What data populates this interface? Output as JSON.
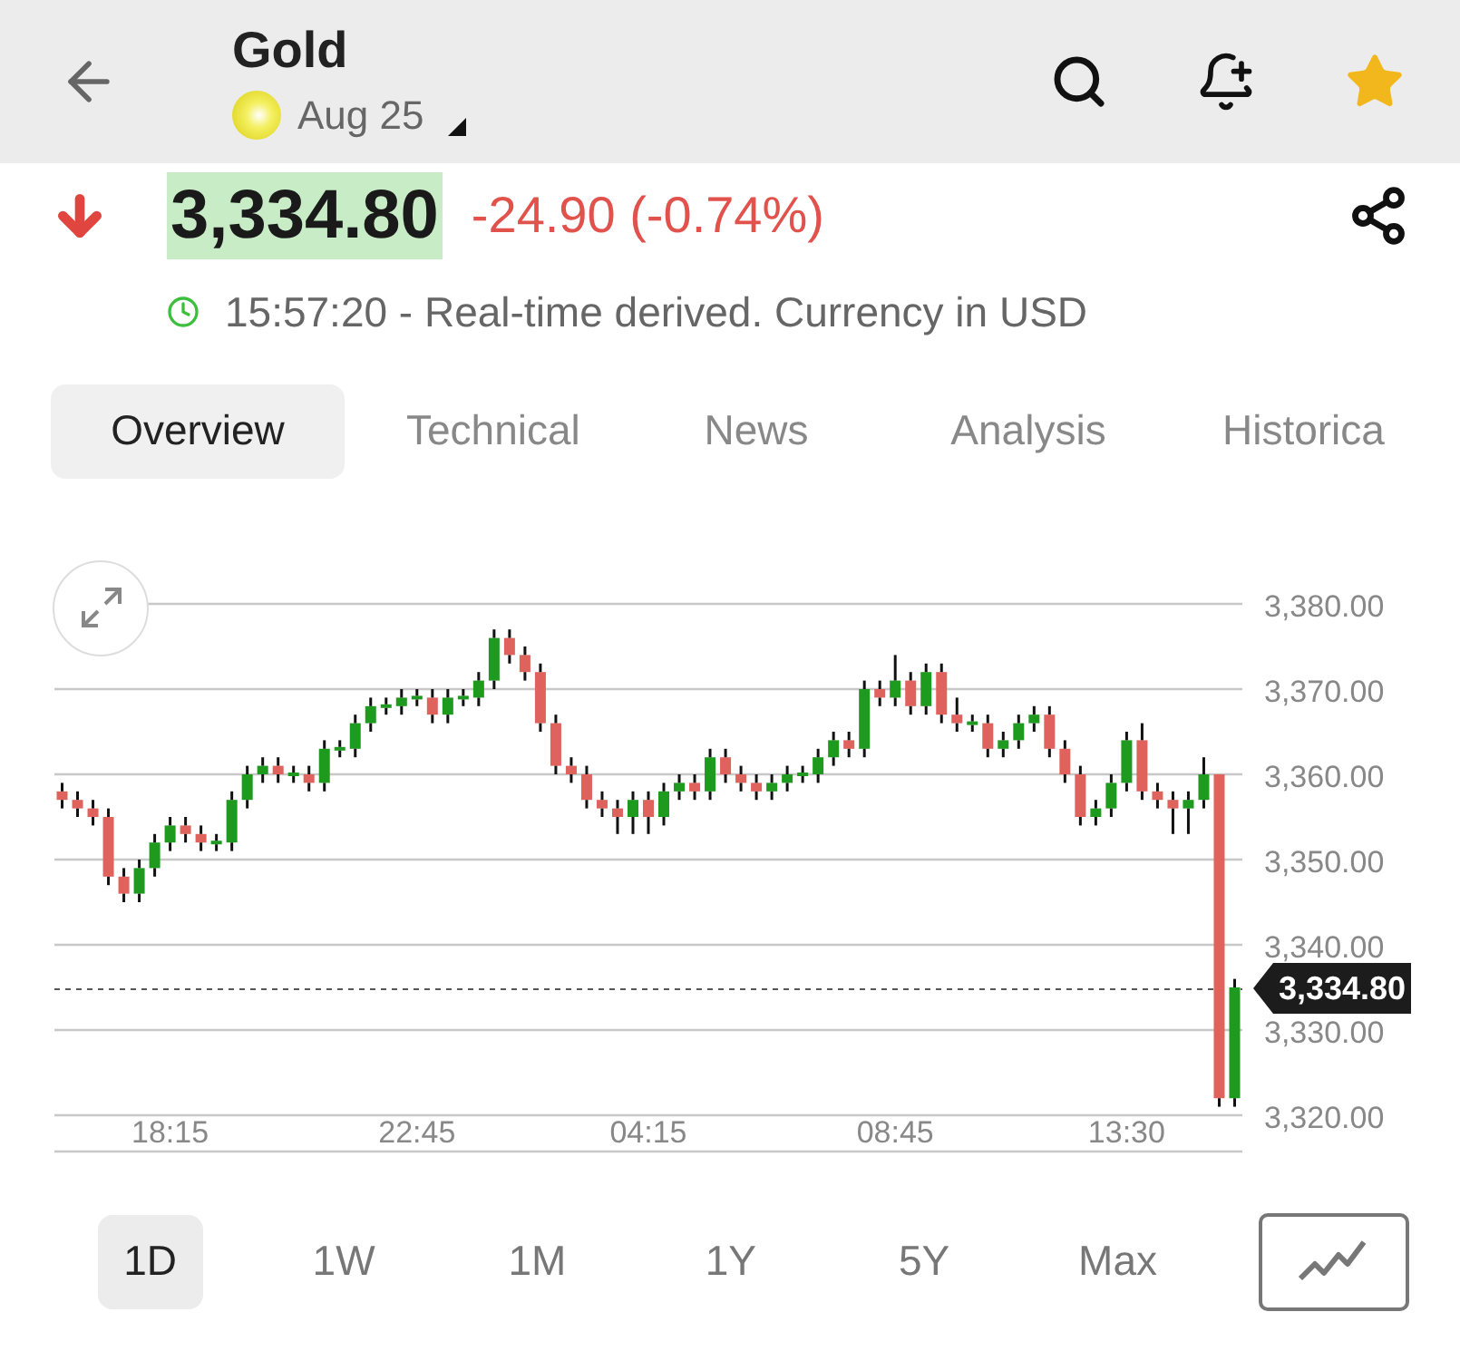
{
  "header": {
    "title": "Gold",
    "contract": "Aug 25"
  },
  "quote": {
    "falling": true,
    "price": "3,334.80",
    "change": "-24.90 (-0.74%)",
    "time_note": "15:57:20 - Real-time derived. Currency in USD"
  },
  "tabs": [
    {
      "label": "Overview",
      "selected": true
    },
    {
      "label": "Technical",
      "selected": false
    },
    {
      "label": "News",
      "selected": false
    },
    {
      "label": "Analysis",
      "selected": false
    },
    {
      "label": "Historica",
      "selected": false
    }
  ],
  "chart": {
    "chart_data": {
      "type": "candlestick",
      "categories": [
        null,
        null,
        null,
        null,
        null,
        null,
        null,
        "18:15",
        null,
        null,
        null,
        null,
        null,
        null,
        null,
        null,
        null,
        null,
        null,
        null,
        null,
        null,
        null,
        "22:45",
        null,
        null,
        null,
        null,
        null,
        null,
        null,
        null,
        null,
        null,
        null,
        null,
        null,
        null,
        "04:15",
        null,
        null,
        null,
        null,
        null,
        null,
        null,
        null,
        null,
        null,
        null,
        null,
        null,
        null,
        null,
        "08:45",
        null,
        null,
        null,
        null,
        null,
        null,
        null,
        null,
        null,
        null,
        null,
        null,
        null,
        null,
        "13:30",
        null,
        null,
        null,
        null,
        null,
        null,
        null
      ],
      "ohlc": [
        [
          3358,
          3359,
          3356,
          3357
        ],
        [
          3357,
          3358,
          3355,
          3356
        ],
        [
          3356,
          3357,
          3354,
          3355
        ],
        [
          3355,
          3356,
          3347,
          3348
        ],
        [
          3348,
          3349,
          3345,
          3346
        ],
        [
          3346,
          3350,
          3345,
          3349
        ],
        [
          3349,
          3353,
          3348,
          3352
        ],
        [
          3352,
          3355,
          3351,
          3354
        ],
        [
          3354,
          3355,
          3352,
          3353
        ],
        [
          3353,
          3354,
          3351,
          3352
        ],
        [
          3352,
          3353,
          3351,
          3352
        ],
        [
          3352,
          3358,
          3351,
          3357
        ],
        [
          3357,
          3361,
          3356,
          3360
        ],
        [
          3360,
          3362,
          3359,
          3361
        ],
        [
          3361,
          3362,
          3359,
          3360
        ],
        [
          3360,
          3361,
          3359,
          3360
        ],
        [
          3360,
          3361,
          3358,
          3359
        ],
        [
          3359,
          3364,
          3358,
          3363
        ],
        [
          3363,
          3364,
          3362,
          3363
        ],
        [
          3363,
          3367,
          3362,
          3366
        ],
        [
          3366,
          3369,
          3365,
          3368
        ],
        [
          3368,
          3369,
          3367,
          3368
        ],
        [
          3368,
          3370,
          3367,
          3369
        ],
        [
          3369,
          3370,
          3368,
          3369
        ],
        [
          3369,
          3370,
          3366,
          3367
        ],
        [
          3367,
          3370,
          3366,
          3369
        ],
        [
          3369,
          3370,
          3368,
          3369
        ],
        [
          3369,
          3372,
          3368,
          3371
        ],
        [
          3371,
          3377,
          3370,
          3376
        ],
        [
          3376,
          3377,
          3373,
          3374
        ],
        [
          3374,
          3375,
          3371,
          3372
        ],
        [
          3372,
          3373,
          3365,
          3366
        ],
        [
          3366,
          3367,
          3360,
          3361
        ],
        [
          3361,
          3362,
          3359,
          3360
        ],
        [
          3360,
          3361,
          3356,
          3357
        ],
        [
          3357,
          3358,
          3355,
          3356
        ],
        [
          3356,
          3357,
          3353,
          3355
        ],
        [
          3355,
          3358,
          3353,
          3357
        ],
        [
          3357,
          3358,
          3353,
          3355
        ],
        [
          3355,
          3359,
          3354,
          3358
        ],
        [
          3358,
          3360,
          3357,
          3359
        ],
        [
          3359,
          3360,
          3357,
          3358
        ],
        [
          3358,
          3363,
          3357,
          3362
        ],
        [
          3362,
          3363,
          3359,
          3360
        ],
        [
          3360,
          3361,
          3358,
          3359
        ],
        [
          3359,
          3360,
          3357,
          3358
        ],
        [
          3358,
          3360,
          3357,
          3359
        ],
        [
          3359,
          3361,
          3358,
          3360
        ],
        [
          3360,
          3361,
          3359,
          3360
        ],
        [
          3360,
          3363,
          3359,
          3362
        ],
        [
          3362,
          3365,
          3361,
          3364
        ],
        [
          3364,
          3365,
          3362,
          3363
        ],
        [
          3363,
          3371,
          3362,
          3370
        ],
        [
          3370,
          3371,
          3368,
          3369
        ],
        [
          3369,
          3374,
          3368,
          3371
        ],
        [
          3371,
          3372,
          3367,
          3368
        ],
        [
          3368,
          3373,
          3367,
          3372
        ],
        [
          3372,
          3373,
          3366,
          3367
        ],
        [
          3367,
          3369,
          3365,
          3366
        ],
        [
          3366,
          3367,
          3365,
          3366
        ],
        [
          3366,
          3367,
          3362,
          3363
        ],
        [
          3363,
          3365,
          3362,
          3364
        ],
        [
          3364,
          3367,
          3363,
          3366
        ],
        [
          3366,
          3368,
          3365,
          3367
        ],
        [
          3367,
          3368,
          3362,
          3363
        ],
        [
          3363,
          3364,
          3359,
          3360
        ],
        [
          3360,
          3361,
          3354,
          3355
        ],
        [
          3355,
          3357,
          3354,
          3356
        ],
        [
          3356,
          3360,
          3355,
          3359
        ],
        [
          3359,
          3365,
          3358,
          3364
        ],
        [
          3364,
          3366,
          3357,
          3358
        ],
        [
          3358,
          3359,
          3356,
          3357
        ],
        [
          3357,
          3358,
          3353,
          3356
        ],
        [
          3356,
          3358,
          3353,
          3357
        ],
        [
          3357,
          3362,
          3356,
          3360
        ],
        [
          3360,
          3360,
          3321,
          3322
        ],
        [
          3322,
          3336,
          3321,
          3335
        ]
      ],
      "ylim": [
        3320,
        3380
      ],
      "grid": true,
      "ref_lines": [
        {
          "axis": "y",
          "value": 3334.8,
          "label": "3,334.80"
        }
      ],
      "yticks": [
        {
          "value": 3380,
          "label": "3,380.00"
        },
        {
          "value": 3370,
          "label": "3,370.00"
        },
        {
          "value": 3360,
          "label": "3,360.00"
        },
        {
          "value": 3350,
          "label": "3,350.00"
        },
        {
          "value": 3340,
          "label": "3,340.00"
        },
        {
          "value": 3330,
          "label": "3,330.00"
        },
        {
          "value": 3320,
          "label": "3,320.00"
        }
      ]
    }
  },
  "periods": [
    {
      "label": "1D",
      "selected": true
    },
    {
      "label": "1W",
      "selected": false
    },
    {
      "label": "1M",
      "selected": false
    },
    {
      "label": "1Y",
      "selected": false
    },
    {
      "label": "5Y",
      "selected": false
    },
    {
      "label": "Max",
      "selected": false
    }
  ]
}
